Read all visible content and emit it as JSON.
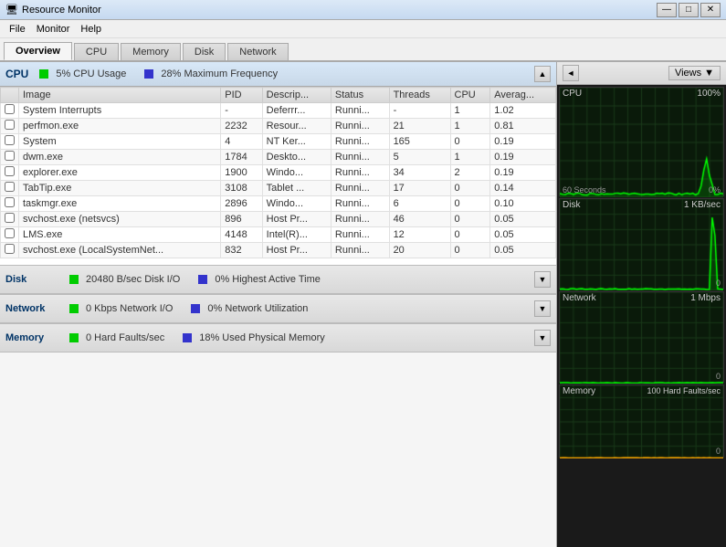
{
  "titleBar": {
    "icon": "📊",
    "title": "Resource Monitor",
    "minimizeLabel": "—",
    "maximizeLabel": "□",
    "closeLabel": "✕"
  },
  "menuBar": {
    "items": [
      "File",
      "Monitor",
      "Help"
    ]
  },
  "tabs": [
    {
      "label": "Overview",
      "active": true
    },
    {
      "label": "CPU",
      "active": false
    },
    {
      "label": "Memory",
      "active": false
    },
    {
      "label": "Disk",
      "active": false
    },
    {
      "label": "Network",
      "active": false
    }
  ],
  "cpu": {
    "title": "CPU",
    "usageIndicatorColor": "#00cc00",
    "usageLabel": "5% CPU Usage",
    "frequencyIndicatorColor": "#3333cc",
    "frequencyLabel": "28% Maximum Frequency",
    "columns": [
      "Image",
      "PID",
      "Descrip...",
      "Status",
      "Threads",
      "CPU",
      "Averag..."
    ],
    "rows": [
      {
        "checked": false,
        "image": "System Interrupts",
        "pid": "-",
        "desc": "Deferrr...",
        "status": "Runni...",
        "threads": "-",
        "cpu": "1",
        "avg": "1.02"
      },
      {
        "checked": false,
        "image": "perfmon.exe",
        "pid": "2232",
        "desc": "Resour...",
        "status": "Runni...",
        "threads": "21",
        "cpu": "1",
        "avg": "0.81"
      },
      {
        "checked": false,
        "image": "System",
        "pid": "4",
        "desc": "NT Ker...",
        "status": "Runni...",
        "threads": "165",
        "cpu": "0",
        "avg": "0.19"
      },
      {
        "checked": false,
        "image": "dwm.exe",
        "pid": "1784",
        "desc": "Deskto...",
        "status": "Runni...",
        "threads": "5",
        "cpu": "1",
        "avg": "0.19"
      },
      {
        "checked": false,
        "image": "explorer.exe",
        "pid": "1900",
        "desc": "Windo...",
        "status": "Runni...",
        "threads": "34",
        "cpu": "2",
        "avg": "0.19"
      },
      {
        "checked": false,
        "image": "TabTip.exe",
        "pid": "3108",
        "desc": "Tablet ...",
        "status": "Runni...",
        "threads": "17",
        "cpu": "0",
        "avg": "0.14"
      },
      {
        "checked": false,
        "image": "taskmgr.exe",
        "pid": "2896",
        "desc": "Windo...",
        "status": "Runni...",
        "threads": "6",
        "cpu": "0",
        "avg": "0.10"
      },
      {
        "checked": false,
        "image": "svchost.exe (netsvcs)",
        "pid": "896",
        "desc": "Host Pr...",
        "status": "Runni...",
        "threads": "46",
        "cpu": "0",
        "avg": "0.05"
      },
      {
        "checked": false,
        "image": "LMS.exe",
        "pid": "4148",
        "desc": "Intel(R)...",
        "status": "Runni...",
        "threads": "12",
        "cpu": "0",
        "avg": "0.05"
      },
      {
        "checked": false,
        "image": "svchost.exe (LocalSystemNet...",
        "pid": "832",
        "desc": "Host Pr...",
        "status": "Runni...",
        "threads": "20",
        "cpu": "0",
        "avg": "0.05"
      }
    ]
  },
  "disk": {
    "title": "Disk",
    "stat1Color": "#00cc00",
    "stat1Label": "20480 B/sec Disk I/O",
    "stat2Color": "#3333cc",
    "stat2Label": "0% Highest Active Time"
  },
  "network": {
    "title": "Network",
    "stat1Color": "#00cc00",
    "stat1Label": "0 Kbps Network I/O",
    "stat2Color": "#3333cc",
    "stat2Label": "0% Network Utilization"
  },
  "memory": {
    "title": "Memory",
    "stat1Color": "#00cc00",
    "stat1Label": "0 Hard Faults/sec",
    "stat2Color": "#3333cc",
    "stat2Label": "18% Used Physical Memory"
  },
  "rightPanel": {
    "expandLabel": "◄",
    "viewsLabel": "Views",
    "charts": [
      {
        "label": "CPU",
        "rightLabel": "100%",
        "bottomLeft": "60 Seconds",
        "bottomRight": "0%",
        "color": "#00ff00"
      },
      {
        "label": "Disk",
        "rightLabel": "1 KB/sec",
        "bottomLeft": "",
        "bottomRight": "0",
        "color": "#00ff00"
      },
      {
        "label": "Network",
        "rightLabel": "1 Mbps",
        "bottomLeft": "",
        "bottomRight": "0",
        "color": "#00ff00"
      },
      {
        "label": "Memory",
        "rightLabel": "100 Hard Faults/sec",
        "bottomLeft": "",
        "bottomRight": "0",
        "color": "#ffaa00"
      }
    ]
  }
}
